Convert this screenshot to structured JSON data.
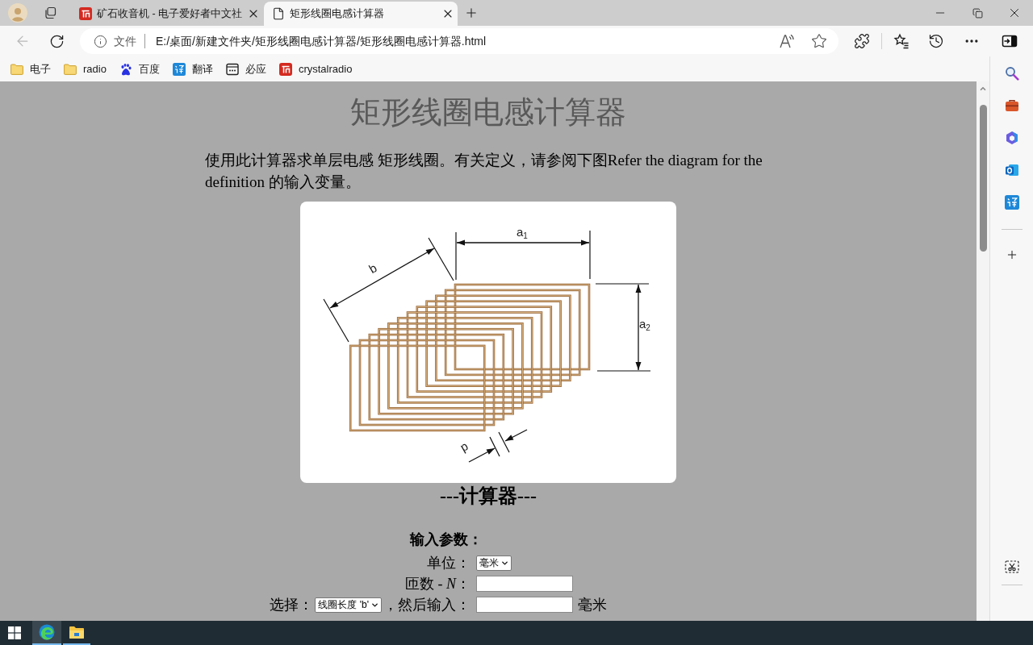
{
  "browser": {
    "tabs": [
      {
        "title": "矿石收音机 - 电子爱好者中文社",
        "selected": false,
        "kind": "site"
      },
      {
        "title": "矩形线圈电感计算器",
        "selected": true,
        "kind": "file"
      }
    ],
    "toolbar": {
      "back_disabled": true
    },
    "address": {
      "scheme": "文件",
      "url": "E:/桌面/新建文件夹/矩形线圈电感计算器/矩形线圈电感计算器.html"
    },
    "bookmarks": [
      {
        "label": "电子",
        "kind": "folder"
      },
      {
        "label": "radio",
        "kind": "folder"
      },
      {
        "label": "百度",
        "kind": "baidu"
      },
      {
        "label": "翻译",
        "kind": "translate"
      },
      {
        "label": "必应",
        "kind": "bing"
      },
      {
        "label": "crystalradio",
        "kind": "site"
      }
    ]
  },
  "page": {
    "title": "矩形线圈电感计算器",
    "intro": "使用此计算器求单层电感 矩形线圈。有关定义，请参阅下图Refer the diagram for the definition 的输入变量。",
    "diagram": {
      "labels": [
        {
          "text": "a",
          "subscript": "1"
        },
        {
          "text": "b"
        },
        {
          "text": "a",
          "subscript": "2"
        },
        {
          "text": "p"
        }
      ]
    },
    "calculator": {
      "heading": "---计算器---",
      "section": "输入参数：",
      "rows": [
        {
          "kind": "select",
          "label": "单位：",
          "value": "毫米"
        },
        {
          "kind": "input",
          "label": "匝数 - *N*："
        },
        {
          "kind": "choice",
          "label": "选择：",
          "select": "线圈长度 'b'",
          "after": "，然后输入：",
          "unit": "毫米"
        }
      ]
    }
  },
  "taskbar": {
    "apps": [
      {
        "kind": "browser",
        "selected": true
      },
      {
        "kind": "files",
        "selected": false
      }
    ]
  }
}
